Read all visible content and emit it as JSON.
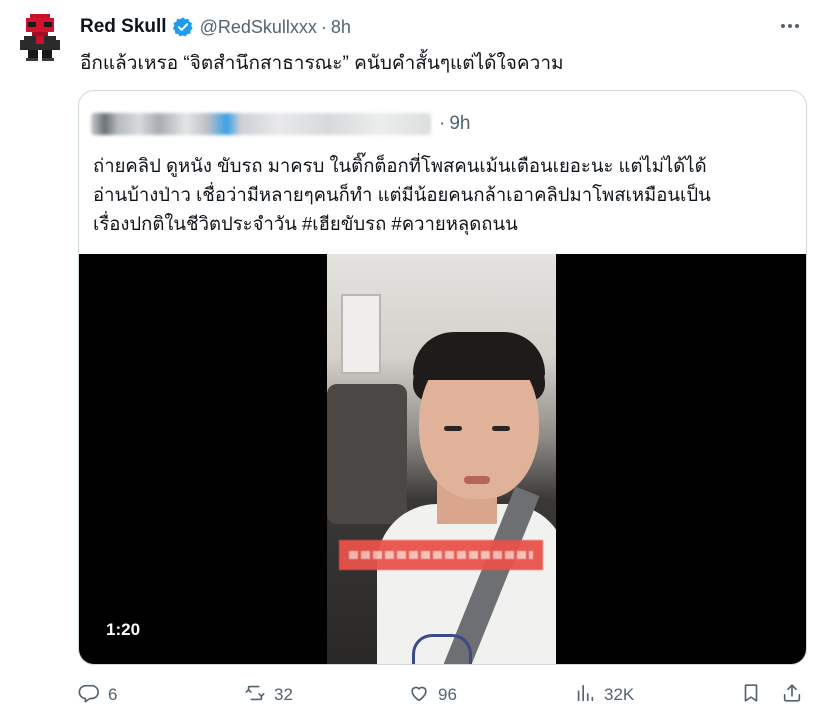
{
  "author": {
    "display_name": "Red Skull",
    "handle": "@RedSkullxxx",
    "separator": "·",
    "time": "8h"
  },
  "tweet": {
    "text": "อีกแล้วเหรอ “จิตสำนึกสาธารณะ” คนับคำสั้นๆแต่ได้ใจความ"
  },
  "quote": {
    "separator": "·",
    "time": "9h",
    "lines": [
      "ถ่ายคลิป ดูหนัง ขับรถ มาครบ ในติ๊กต็อกที่โพสคนเม้นเตือนเยอะนะ แต่ไม่ได้ได้",
      "อ่านบ้างป่าว เชื่อว่ามีหลายๆคนก็ทำ แต่มีน้อยคนกล้าเอาคลิปมาโพสเหมือนเป็น",
      "เรื่องปกติในชีวิตประจำวัน #เฮียขับรถ #ควายหลุดถนน"
    ],
    "video": {
      "duration": "1:20"
    }
  },
  "actions": {
    "replies": "6",
    "retweets": "32",
    "likes": "96",
    "views": "32K"
  },
  "icons": {
    "verified": "verified-badge-icon",
    "reply": "reply-icon",
    "retweet": "retweet-icon",
    "like": "heart-icon",
    "views": "views-icon",
    "bookmark": "bookmark-icon",
    "share": "share-icon",
    "more": "more-icon"
  },
  "colors": {
    "verified": "#1d9bf0",
    "secondary_text": "#536471",
    "border": "#cfd9de"
  }
}
